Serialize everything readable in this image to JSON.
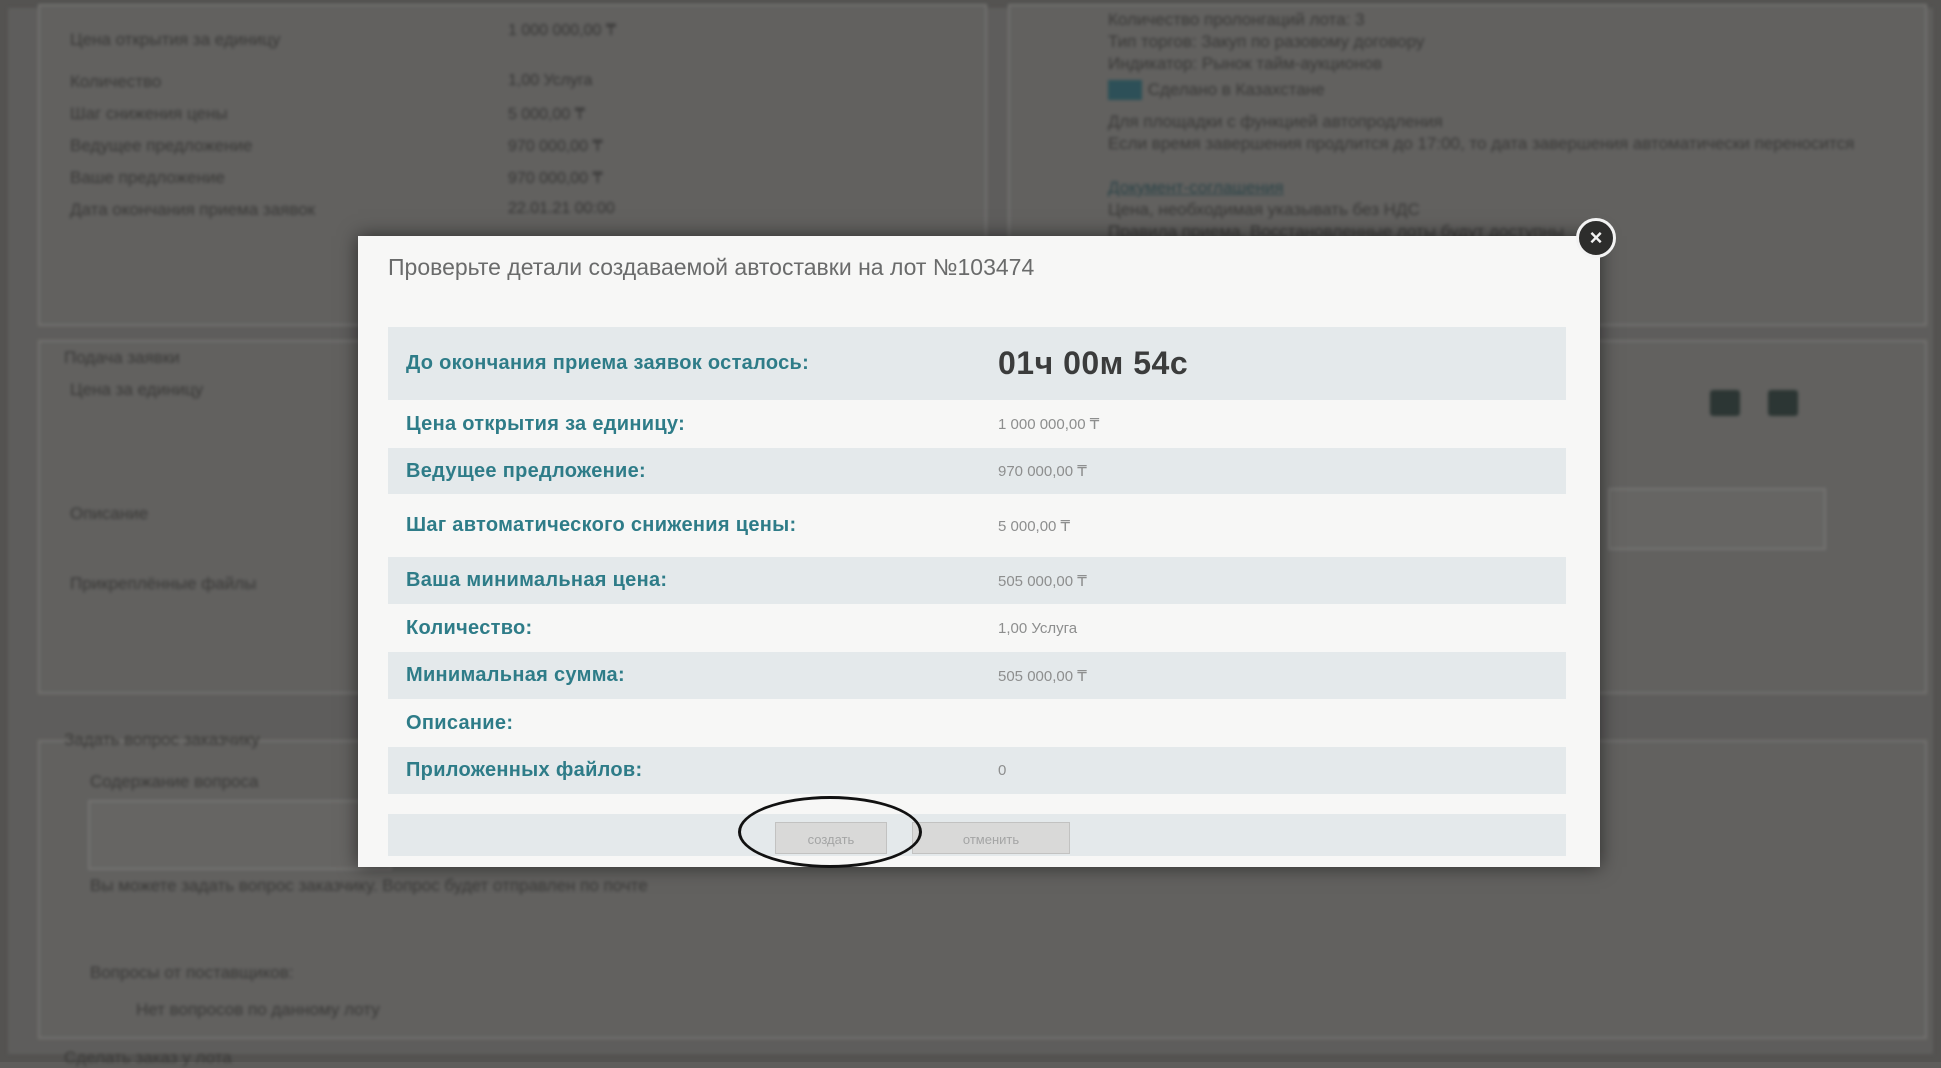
{
  "modal": {
    "title": "Проверьте детали создаваемой автоставки на лот №103474",
    "close_icon": "×",
    "rows": [
      {
        "label": "До окончания приема заявок осталось:",
        "value": "01ч 00м 54с"
      },
      {
        "label": "Цена открытия за единицу:",
        "value": "1 000 000,00 ₸"
      },
      {
        "label": "Ведущее предложение:",
        "value": "970 000,00 ₸"
      },
      {
        "label": "Шаг автоматического снижения цены:",
        "value": "5 000,00 ₸"
      },
      {
        "label": "Ваша минимальная цена:",
        "value": "505 000,00 ₸"
      },
      {
        "label": "Количество:",
        "value": "1,00 Услуга"
      },
      {
        "label": "Минимальная сумма:",
        "value": "505 000,00 ₸"
      },
      {
        "label": "Описание:",
        "value": ""
      },
      {
        "label": "Приложенных файлов:",
        "value": "0"
      }
    ],
    "submit_label": "создать",
    "cancel_label": "отменить"
  },
  "background": {
    "lot_info": [
      {
        "label": "Цена открытия за единицу",
        "value": "1 000 000,00 ₸"
      },
      {
        "label": "Количество",
        "value": "1,00 Услуга"
      },
      {
        "label": "Шаг снижения цены",
        "value": "5 000,00 ₸"
      },
      {
        "label": "Ведущее предложение",
        "value": "970 000,00 ₸"
      },
      {
        "label": "Ваше предложение",
        "value": "970 000,00 ₸"
      },
      {
        "label": "Дата окончания приема заявок",
        "value": "22.01.21 00:00"
      }
    ],
    "info_items": [
      "Количество пролонгаций лота: 3",
      "Тип торгов: Закуп по разовому договору",
      "Индикатор: Рынок тайм-аукционов",
      "Сделано в Казахстане",
      "Для площадки с функцией автопродления",
      "Если время завершения продлится до 17:00, то дата завершения автоматически переносится",
      "Документ-соглашения",
      "Цена, необходимая указывать без НДС",
      "Правила приема. Восстановленные лоты будут доступны"
    ],
    "bid_section_title": "Подача заявки",
    "bid_price_label": "Цена за единицу",
    "description_label": "Описание",
    "files_label": "Прикреплённые файлы",
    "question_section_title": "Задать вопрос заказчику",
    "question_content_label": "Содержание вопроса",
    "question_hint": "Вы можете задать вопрос заказчику. Вопрос будет отправлен по почте",
    "questions_title": "Вопросы от поставщиков:",
    "no_questions": "Нет вопросов по данному лоту",
    "footer_title": "Сделать заказ у лота"
  }
}
